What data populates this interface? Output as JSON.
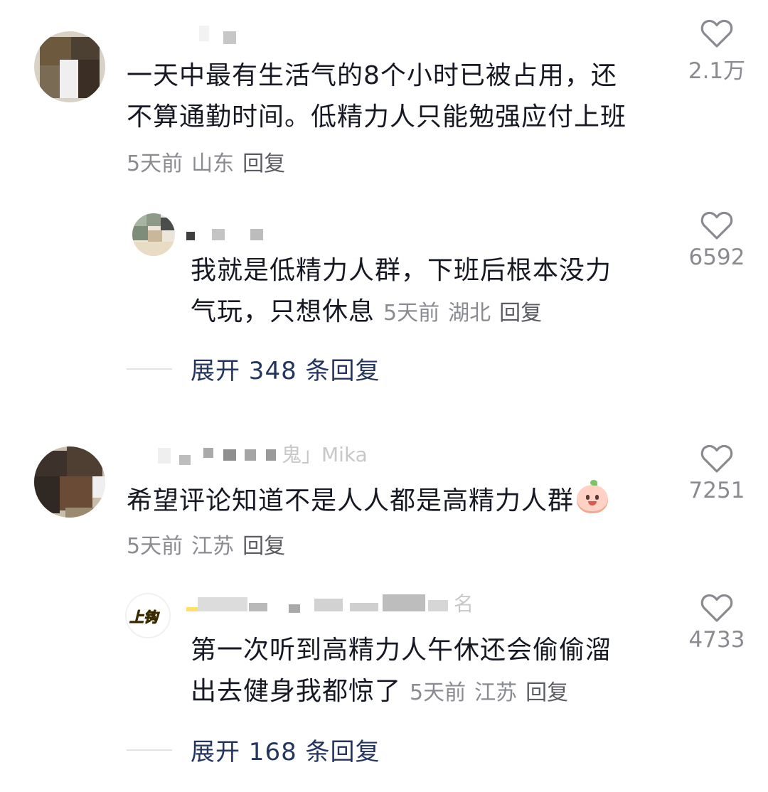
{
  "comments": [
    {
      "text_lines": [
        "一天中最有生活气的8个小时已被占用，还",
        "不算通勤时间。低精力人只能勉强应付上班"
      ],
      "time": "5天前",
      "location": "山东",
      "reply_label": "回复",
      "likes": "2.1万",
      "replies": [
        {
          "text_lines": [
            "我就是低精力人群，下班后根本没力",
            "气玩，只想休息"
          ],
          "time": "5天前",
          "location": "湖北",
          "reply_label": "回复",
          "likes": "6592"
        }
      ],
      "expand_label": "展开 348 条回复"
    },
    {
      "username_partial": "鬼」Mika",
      "text": "希望评论知道不是人人都是高精力人群",
      "emoji": "smiling-peach-emoji",
      "time": "5天前",
      "location": "江苏",
      "reply_label": "回复",
      "likes": "7251",
      "replies": [
        {
          "avatar_text": "上钩",
          "username_partial": "名",
          "text_lines": [
            "第一次听到高精力人午休还会偷偷溜",
            "出去健身我都惊了"
          ],
          "time": "5天前",
          "location": "江苏",
          "reply_label": "回复",
          "likes": "4733"
        }
      ],
      "expand_label": "展开 168 条回复"
    }
  ],
  "colors": {
    "text": "#161823",
    "meta": "#8a8b91",
    "expand": "#24365f",
    "heart": "#8a8b91"
  },
  "icons": {
    "like": "heart-outline-icon"
  }
}
